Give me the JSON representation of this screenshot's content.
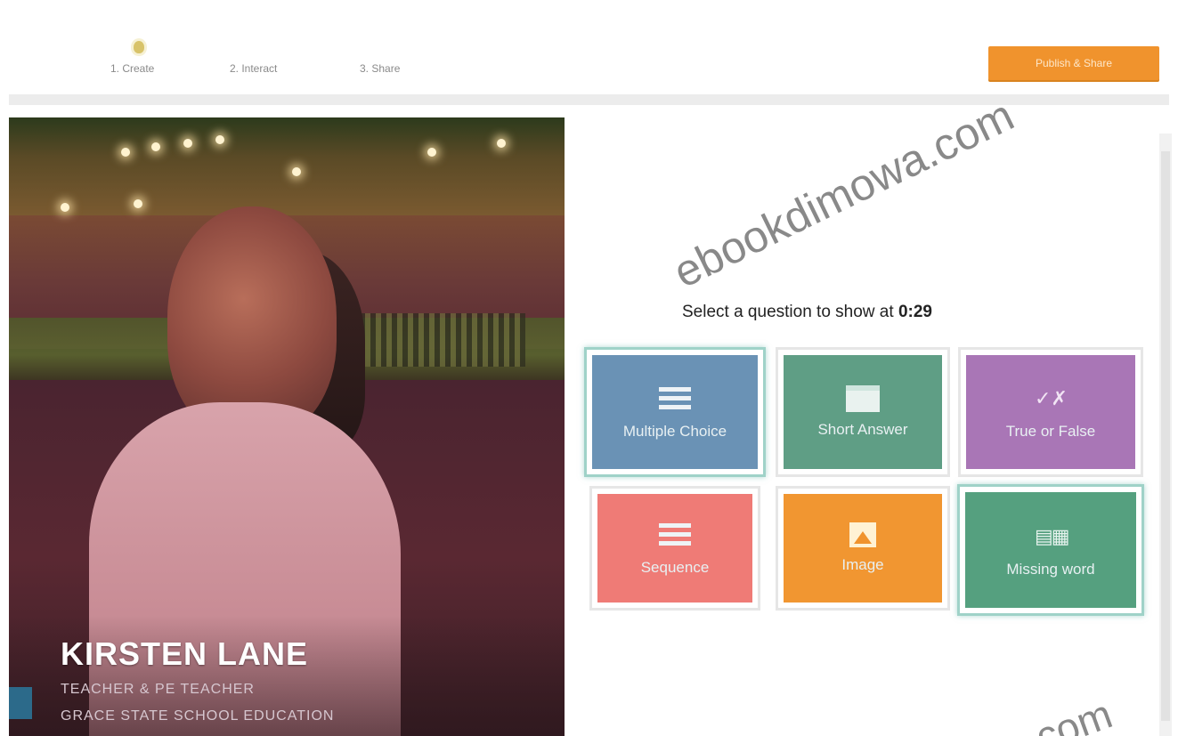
{
  "steps": {
    "step1": "1. Create",
    "step2": "2. Interact",
    "step3": "3. Share"
  },
  "header": {
    "publish_label": "Publish & Share"
  },
  "video": {
    "name": "KIRSTEN LANE",
    "role": "TEACHER & PE TEACHER",
    "org": "GRACE STATE SCHOOL EDUCATION"
  },
  "picker": {
    "prompt_prefix": "Select a question to show at ",
    "time": "0:29",
    "tiles": [
      {
        "label": "Multiple Choice",
        "color": "#6a92b5",
        "icon": "list-icon"
      },
      {
        "label": "Short Answer",
        "color": "#5f9e85",
        "icon": "text-box-icon"
      },
      {
        "label": "True or False",
        "color": "#a976b6",
        "icon": "true-false-icon"
      },
      {
        "label": "Sequence",
        "color": "#ef7b76",
        "icon": "sequence-icon"
      },
      {
        "label": "Image",
        "color": "#f19631",
        "icon": "image-icon"
      },
      {
        "label": "Missing word",
        "color": "#55a07f",
        "icon": "missing-word-icon"
      }
    ]
  },
  "watermark": {
    "text": "ebookdimowa.com",
    "text2": ".com"
  }
}
